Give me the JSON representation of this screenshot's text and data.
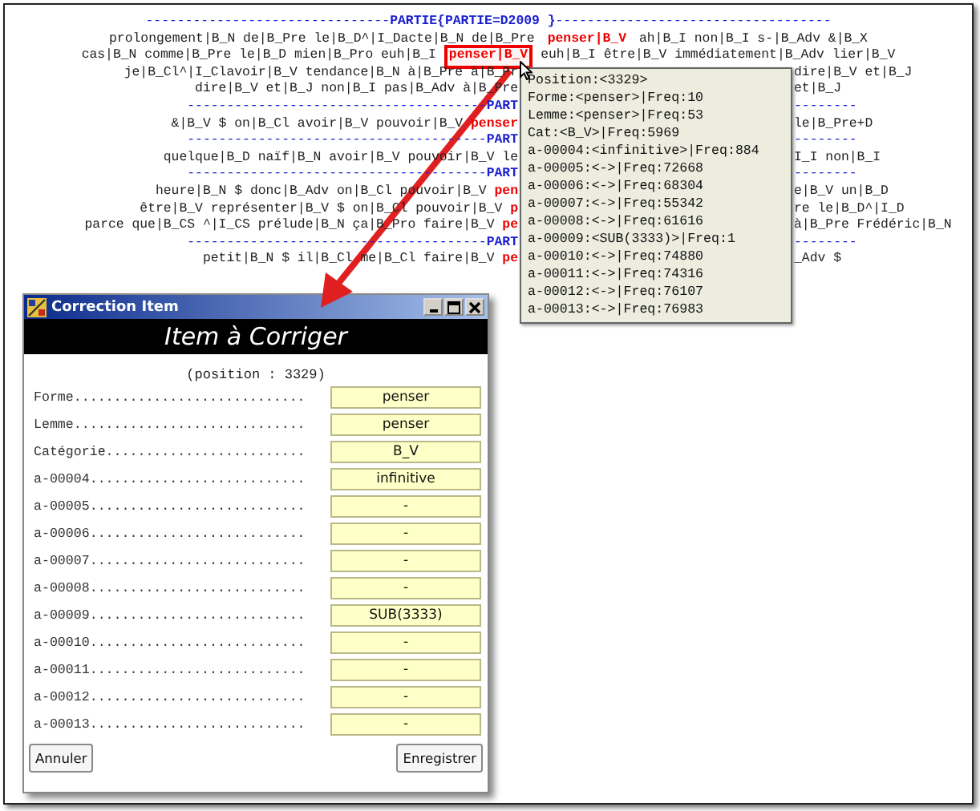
{
  "concordance": {
    "lines": [
      {
        "kind": "header",
        "left": "-------------------------------",
        "label": "PARTIE{PARTIE=D2009 }",
        "right": "-----------------------------------"
      },
      {
        "kind": "line",
        "left": "prolongement|B_N de|B_Pre le|B_D^|I_Dacte|B_N de|B_Pre",
        "keyword": "penser|B_V",
        "right": "ah|B_I non|B_I s-|B_Adv &|B_X",
        "highlighted": false
      },
      {
        "kind": "line",
        "left": "cas|B_N comme|B_Pre le|B_D mien|B_Pro euh|B_I",
        "keyword": "penser|B_V",
        "right": "euh|B_I être|B_V immédiatement|B_Adv lier|B_V",
        "highlighted": true
      },
      {
        "kind": "line",
        "left": "je|B_Cl^|I_Clavoir|B_V tendance|B_N à|B_Pre à|B_Pr",
        "right": "dire|B_V et|B_J"
      },
      {
        "kind": "line",
        "left": "dire|B_V et|B_J non|B_I pas|B_Adv à|B_Pre",
        "right": "et|B_J"
      },
      {
        "kind": "header",
        "left": "--------------------------------------",
        "label": "PART",
        "right": "--------"
      },
      {
        "kind": "line",
        "left": "&|B_V $ on|B_Cl avoir|B_V pouvoir|B_V",
        "keyword": "penser",
        "right": "le|B_Pre+D"
      },
      {
        "kind": "header",
        "left": "--------------------------------------",
        "label": "PART",
        "right": "--------"
      },
      {
        "kind": "line",
        "left": "quelque|B_D naïf|B_N avoir|B_V pouvoir|B_V le",
        "right": "I_I non|B_I"
      },
      {
        "kind": "header",
        "left": "--------------------------------------",
        "label": "PART",
        "right": "--------"
      },
      {
        "kind": "line",
        "left": "heure|B_N $ donc|B_Adv on|B_Cl pouvoir|B_V",
        "keyword": "pen",
        "right": "e|B_V un|B_D"
      },
      {
        "kind": "line",
        "left": "être|B_V représenter|B_V $ on|B_Cl pouvoir|B_V",
        "keyword": "p",
        "right": "re le|B_D^|I_D"
      },
      {
        "kind": "line",
        "left": "parce que|B_CS ^|I_CS prélude|B_N ça|B_Pro faire|B_V",
        "keyword": "pe",
        "right": "à|B_Pre Frédéric|B_N"
      },
      {
        "kind": "header",
        "left": "--------------------------------------",
        "label": "PART",
        "right": "--------"
      },
      {
        "kind": "line",
        "left": "petit|B_N $ il|B_Cl me|B_Cl faire|B_V",
        "keyword": "pe",
        "right": "_Adv $"
      }
    ]
  },
  "tooltip": {
    "lines": [
      "Position:<3329>",
      "Forme:<penser>|Freq:10",
      "Lemme:<penser>|Freq:53",
      "Cat:<B_V>|Freq:5969",
      "a-00004:<infinitive>|Freq:884",
      "a-00005:<->|Freq:72668",
      "a-00006:<->|Freq:68304",
      "a-00007:<->|Freq:55342",
      "a-00008:<->|Freq:61616",
      "a-00009:<SUB(3333)>|Freq:1",
      "a-00010:<->|Freq:74880",
      "a-00011:<->|Freq:74316",
      "a-00012:<->|Freq:76107",
      "a-00013:<->|Freq:76983"
    ]
  },
  "dialog": {
    "title": "Correction Item",
    "banner": "Item à Corriger",
    "position": "(position : 3329)",
    "fields": [
      {
        "label": "Forme.............................",
        "value": "penser"
      },
      {
        "label": "Lemme.............................",
        "value": "penser"
      },
      {
        "label": "Catégorie.........................",
        "value": "B_V"
      },
      {
        "label": "a-00004...........................",
        "value": "infinitive"
      },
      {
        "label": "a-00005...........................",
        "value": "-"
      },
      {
        "label": "a-00006...........................",
        "value": "-"
      },
      {
        "label": "a-00007...........................",
        "value": "-"
      },
      {
        "label": "a-00008...........................",
        "value": "-"
      },
      {
        "label": "a-00009...........................",
        "value": "SUB(3333)"
      },
      {
        "label": "a-00010...........................",
        "value": "-"
      },
      {
        "label": "a-00011...........................",
        "value": "-"
      },
      {
        "label": "a-00012...........................",
        "value": "-"
      },
      {
        "label": "a-00013...........................",
        "value": "-"
      }
    ],
    "buttons": [
      "Annuler",
      "Enregistrer"
    ]
  }
}
